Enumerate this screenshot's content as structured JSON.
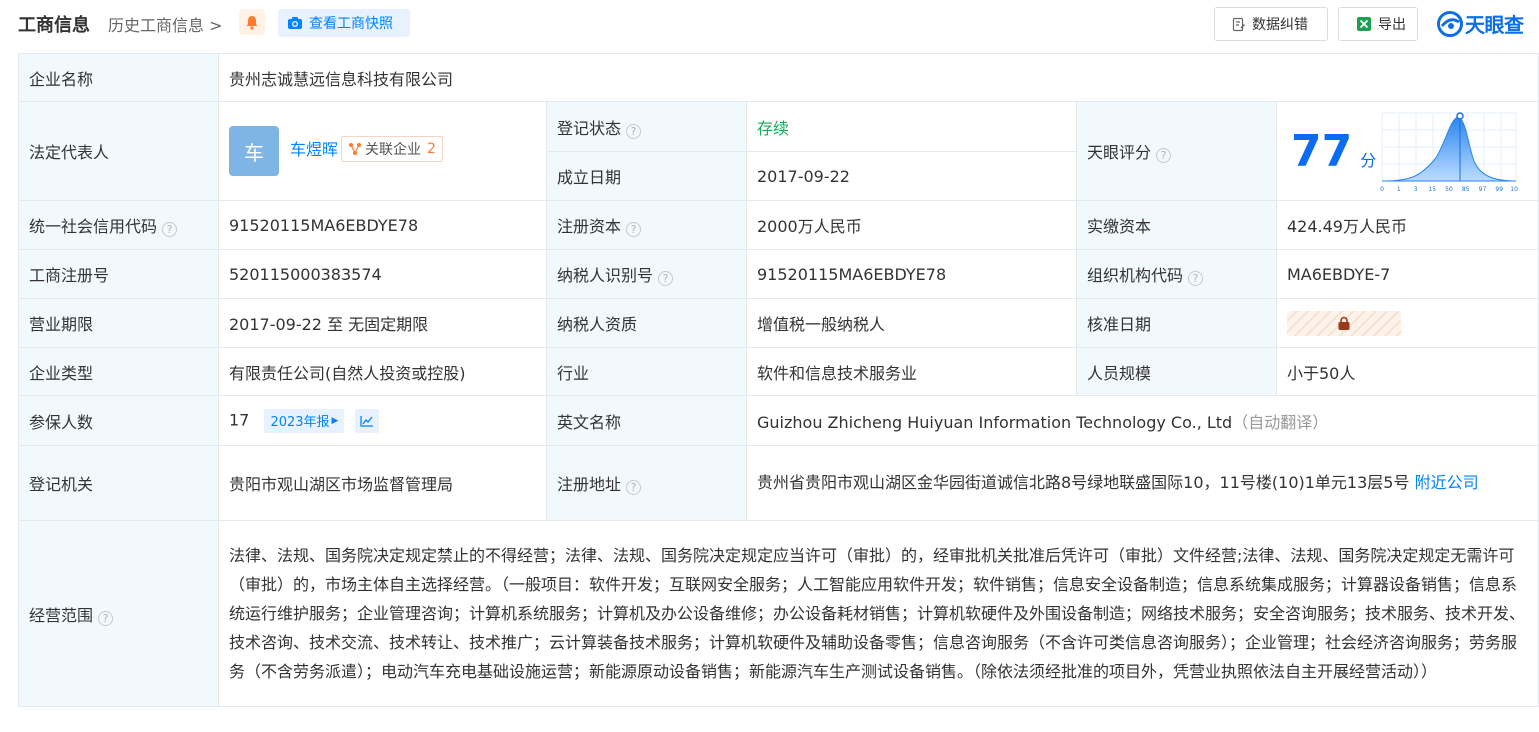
{
  "header": {
    "title": "工商信息",
    "history_link": "历史工商信息",
    "snapshot_button": "查看工商快照",
    "correction_button": "数据纠错",
    "export_button": "导出",
    "logo_text": "天眼查"
  },
  "colors": {
    "accent": "#0084ff",
    "label_bg": "#f2f9fc",
    "status_green": "#18a957",
    "border": "#e5e8ef"
  },
  "company": {
    "name_label": "企业名称",
    "name": "贵州志诚慧远信息科技有限公司",
    "legal_rep_label": "法定代表人",
    "legal_rep_avatar": "车",
    "legal_rep_name": "车煜晖",
    "related_label": "关联企业",
    "related_count": "2",
    "status_label": "登记状态",
    "status": "存续",
    "est_date_label": "成立日期",
    "est_date": "2017-09-22",
    "score_label": "天眼评分",
    "score": "77",
    "score_unit": "分",
    "credit_code_label": "统一社会信用代码",
    "credit_code": "91520115MA6EBDYE78",
    "reg_capital_label": "注册资本",
    "reg_capital": "2000万人民币",
    "paid_capital_label": "实缴资本",
    "paid_capital": "424.49万人民币",
    "reg_no_label": "工商注册号",
    "reg_no": "520115000383574",
    "taxpayer_id_label": "纳税人识别号",
    "taxpayer_id": "91520115MA6EBDYE78",
    "org_code_label": "组织机构代码",
    "org_code": "MA6EBDYE-7",
    "term_label": "营业期限",
    "term": "2017-09-22 至 无固定期限",
    "taxpayer_qual_label": "纳税人资质",
    "taxpayer_qual": "增值税一般纳税人",
    "approve_date_label": "核准日期",
    "type_label": "企业类型",
    "type": "有限责任公司(自然人投资或控股)",
    "industry_label": "行业",
    "industry": "软件和信息技术服务业",
    "staff_size_label": "人员规模",
    "staff_size": "小于50人",
    "insured_label": "参保人数",
    "insured": "17",
    "insured_report": "2023年报",
    "english_name_label": "英文名称",
    "english_name": "Guizhou Zhicheng Huiyuan Information Technology Co., Ltd",
    "auto_translate": "（自动翻译）",
    "authority_label": "登记机关",
    "authority": "贵阳市观山湖区市场监督管理局",
    "address_label": "注册地址",
    "address": "贵州省贵阳市观山湖区金华园街道诚信北路8号绿地联盛国际10，11号楼(10)1单元13层5号",
    "nearby_link": "附近公司",
    "scope_label": "经营范围",
    "scope": "法律、法规、国务院决定规定禁止的不得经营；法律、法规、国务院决定规定应当许可（审批）的，经审批机关批准后凭许可（审批）文件经营;法律、法规、国务院决定规定无需许可（审批）的，市场主体自主选择经营。（一般项目：软件开发；互联网安全服务；人工智能应用软件开发；软件销售；信息安全设备制造；信息系统集成服务；计算器设备销售；信息系统运行维护服务；企业管理咨询；计算机系统服务；计算机及办公设备维修；办公设备耗材销售；计算机软硬件及外围设备制造；网络技术服务；安全咨询服务；技术服务、技术开发、技术咨询、技术交流、技术转让、技术推广；云计算装备技术服务；计算机软硬件及辅助设备零售；信息咨询服务（不含许可类信息咨询服务）；企业管理；社会经济咨询服务；劳务服务（不含劳务派遣）；电动汽车充电基础设施运营；新能源原动设备销售；新能源汽车生产测试设备销售。（除依法须经批准的项目外，凭营业执照依法自主开展经营活动））"
  },
  "score_chart": {
    "x_ticks": [
      "0",
      "1",
      "3",
      "15",
      "50",
      "85",
      "97",
      "99",
      "100"
    ],
    "marker_tick": "85"
  }
}
